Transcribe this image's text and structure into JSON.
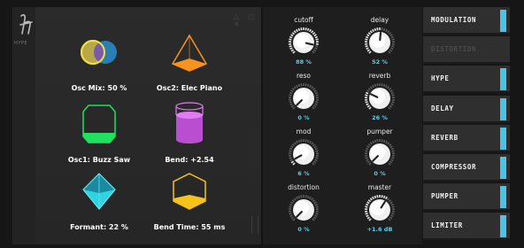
{
  "brand": {
    "logo_text": "HYPE"
  },
  "shapes": [
    {
      "name": "osc-mix-venn-icon",
      "label": "Osc Mix: 50 %"
    },
    {
      "name": "osc2-pyramid-icon",
      "label": "Osc2: Elec Piano"
    },
    {
      "name": "osc1-prism-icon",
      "label": "Osc1: Buzz Saw"
    },
    {
      "name": "bend-cylinder-icon",
      "label": "Bend: +2.54"
    },
    {
      "name": "formant-diamond-icon",
      "label": "Formant: 22 %"
    },
    {
      "name": "bend-time-cube-icon",
      "label": "Bend Time: 55 ms"
    }
  ],
  "knobs": [
    {
      "name": "cutoff",
      "label": "cutoff",
      "value": "88 %",
      "level": 0.88
    },
    {
      "name": "delay",
      "label": "delay",
      "value": "52 %",
      "level": 0.52
    },
    {
      "name": "reso",
      "label": "reso",
      "value": "0 %",
      "level": 0.0
    },
    {
      "name": "reverb",
      "label": "reverb",
      "value": "26 %",
      "level": 0.26
    },
    {
      "name": "mod",
      "label": "mod",
      "value": "6 %",
      "level": 0.06
    },
    {
      "name": "pumper",
      "label": "pumper",
      "value": "0 %",
      "level": 0.0
    },
    {
      "name": "distortion",
      "label": "distortion",
      "value": "0 %",
      "level": 0.0
    },
    {
      "name": "master",
      "label": "master",
      "value": "+1.6 dB",
      "level": 0.62
    }
  ],
  "nav": [
    {
      "label": "MODULATION",
      "enabled": true
    },
    {
      "label": "DISTORTION",
      "enabled": false
    },
    {
      "label": "HYPE",
      "enabled": true
    },
    {
      "label": "DELAY",
      "enabled": true
    },
    {
      "label": "REVERB",
      "enabled": true
    },
    {
      "label": "COMPRESSOR",
      "enabled": true
    },
    {
      "label": "PUMPER",
      "enabled": true
    },
    {
      "label": "LIMITER",
      "enabled": true
    }
  ],
  "colors": {
    "accent": "#4ec2e4",
    "value_text": "#4ad5f2",
    "knob_arc": "#c9c9c9"
  }
}
